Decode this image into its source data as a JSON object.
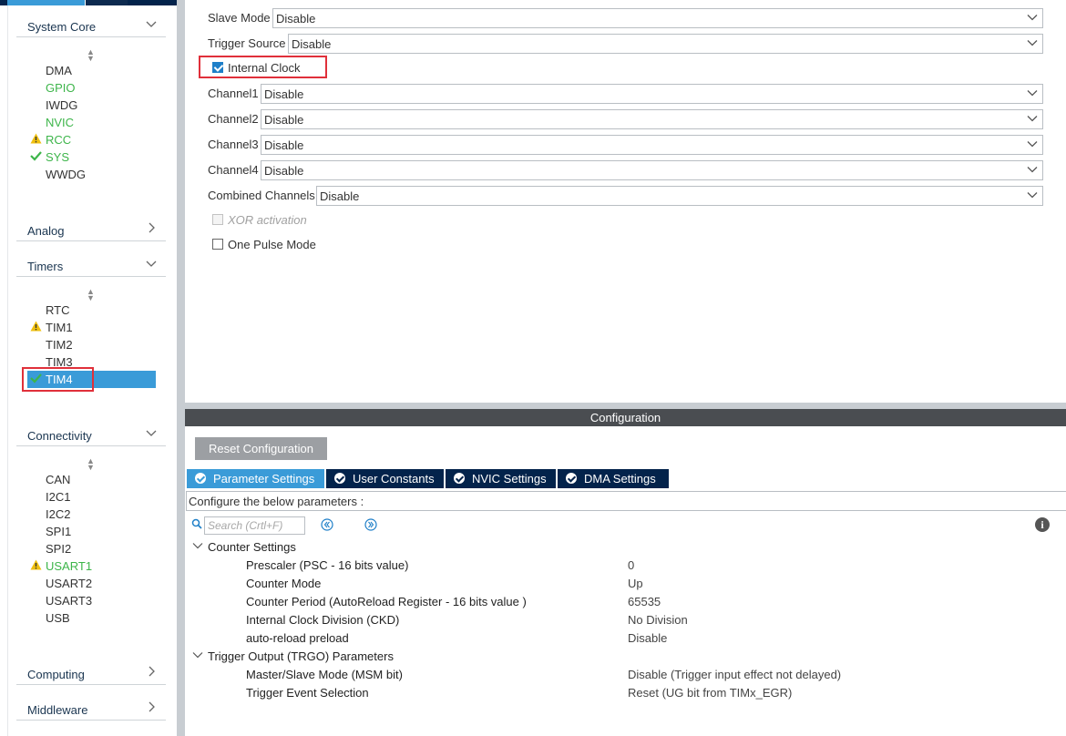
{
  "sidebar": {
    "categories": {
      "system_core": "System Core",
      "analog": "Analog",
      "timers": "Timers",
      "connectivity": "Connectivity",
      "computing": "Computing",
      "middleware": "Middleware"
    },
    "system_core_items": [
      "DMA",
      "GPIO",
      "IWDG",
      "NVIC",
      "RCC",
      "SYS",
      "WWDG"
    ],
    "timers_items": [
      "RTC",
      "TIM1",
      "TIM2",
      "TIM3",
      "TIM4"
    ],
    "connectivity_items": [
      "CAN",
      "I2C1",
      "I2C2",
      "SPI1",
      "SPI2",
      "USART1",
      "USART2",
      "USART3",
      "USB"
    ],
    "selected": "TIM4"
  },
  "mode": {
    "slave_mode": {
      "label": "Slave Mode",
      "value": "Disable"
    },
    "trigger_source": {
      "label": "Trigger Source",
      "value": "Disable"
    },
    "internal_clock": {
      "label": "Internal Clock",
      "checked": true
    },
    "channel1": {
      "label": "Channel1",
      "value": "Disable"
    },
    "channel2": {
      "label": "Channel2",
      "value": "Disable"
    },
    "channel3": {
      "label": "Channel3",
      "value": "Disable"
    },
    "channel4": {
      "label": "Channel4",
      "value": "Disable"
    },
    "combined_channels": {
      "label": "Combined Channels",
      "value": "Disable"
    },
    "xor_activation": {
      "label": "XOR activation",
      "checked": false,
      "disabled": true
    },
    "one_pulse_mode": {
      "label": "One Pulse Mode",
      "checked": false
    }
  },
  "config": {
    "title": "Configuration",
    "reset_label": "Reset Configuration",
    "tabs": [
      "Parameter Settings",
      "User Constants",
      "NVIC Settings",
      "DMA Settings"
    ],
    "active_tab": "Parameter Settings",
    "hint": "Configure the below parameters :",
    "search_placeholder": "Search (Crtl+F)",
    "groups": [
      {
        "name": "Counter Settings",
        "params": [
          {
            "name": "Prescaler (PSC - 16 bits value)",
            "value": "0"
          },
          {
            "name": "Counter Mode",
            "value": "Up"
          },
          {
            "name": "Counter Period (AutoReload Register - 16 bits value )",
            "value": "65535"
          },
          {
            "name": "Internal Clock Division (CKD)",
            "value": "No Division"
          },
          {
            "name": "auto-reload preload",
            "value": "Disable"
          }
        ]
      },
      {
        "name": "Trigger Output (TRGO) Parameters",
        "params": [
          {
            "name": "Master/Slave Mode (MSM bit)",
            "value": "Disable (Trigger input effect not delayed)"
          },
          {
            "name": "Trigger Event Selection",
            "value": "Reset (UG bit from TIMx_EGR)"
          }
        ]
      }
    ]
  },
  "colors": {
    "accent": "#3a9bd8",
    "navy": "#03234b",
    "green": "#3db54a",
    "warning": "#f0c010",
    "highlight_box": "#e0303a"
  }
}
